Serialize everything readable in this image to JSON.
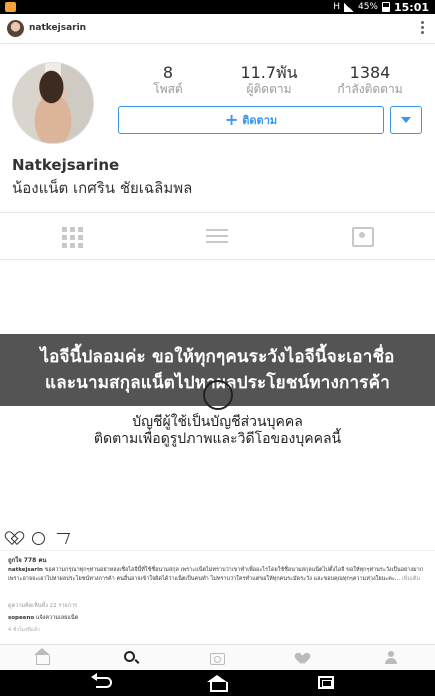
{
  "status_bar": {
    "time": "15:01",
    "battery": "45%",
    "network": "H"
  },
  "top_bar": {
    "username": "natkejsarin"
  },
  "profile": {
    "stats": [
      {
        "value": "8",
        "label": "โพสต์"
      },
      {
        "value": "11.7พัน",
        "label": "ผู้ติดตาม"
      },
      {
        "value": "1384",
        "label": "กำลังติดตาม"
      }
    ],
    "follow_label": "ติดตาม",
    "full_name": "Natkejsarine",
    "bio": "น้องแน็ต เกศริน ชัยเฉลิมพล"
  },
  "overlay": {
    "line1": "ไอจีนี้ปลอมค่ะ ขอให้ทุกๆคนระวังไอจีนี้จะเอาชื่อ",
    "line2": "และนามสกุลแน็ตไปหาผลประโยชน์ทางการค้า"
  },
  "private_notice": {
    "line1": "บัญชีผู้ใช้เป็นบัญชีส่วนบุคคล",
    "line2": "ติดตามเพื่อดูรูปภาพและวิดีโอของบุคคลนี้"
  },
  "feed": {
    "likes": "ถูกใจ 778 คน",
    "caption_user": "natkejsarin",
    "caption_text": "ขอความกรุณาทุกๆท่านอย่าหลงเชื่อไอจีนี้ที่ใช้ชื่อนามสกุล เพราะแน็ตไม่ทราบว่าเขาทำเพื่ออะไรโดยใช้ชื่อนามสกุลแน็ตไปตั้งไอจี ขอให้ทุกๆท่านระวังเป็นอย่างมากเพราะอาจจะเอาไปหาผลประโยชน์ทางการค้า คนอื่นอาจเข้าใจผิดได้ว่าแน็ตเป็นคนทำ ไม่ทราบว่าใครทำแต่ขอให้ทุกคนระมัดระวัง และขอบคุณทุกๆความห่วงใยนะคะ...",
    "more_label": "เพิ่มเติม",
    "view_all": "ดูความคิดเห็นทั้ง 22 รายการ",
    "comment_user": "sopeeno",
    "comment_text": "แจ้งความเลยแน็ต",
    "timestamp": "4 ชั่วโมงที่แล้ว"
  }
}
